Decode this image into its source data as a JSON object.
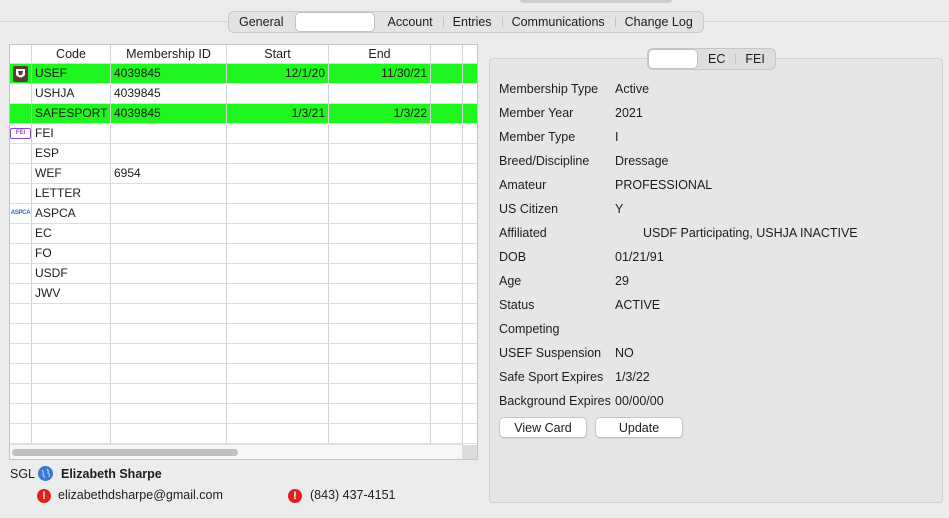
{
  "top_tabs": [
    {
      "label": ""
    },
    {
      "label": "General"
    },
    {
      "label": "Account"
    },
    {
      "label": "Entries"
    },
    {
      "label": "Communications"
    },
    {
      "label": "Change Log"
    }
  ],
  "table": {
    "headers": [
      "",
      "Code",
      "Membership ID",
      "Start",
      "End",
      ""
    ],
    "rows": [
      {
        "icon": "usef-logo-icon",
        "code": "USEF",
        "id": "4039845",
        "start": "12/1/20",
        "end": "11/30/21",
        "highlight": true
      },
      {
        "icon": "",
        "code": "USHJA",
        "id": "4039845",
        "start": "",
        "end": "",
        "highlight": false
      },
      {
        "icon": "",
        "code": "SAFESPORT",
        "id": "4039845",
        "start": "1/3/21",
        "end": "1/3/22",
        "highlight": true
      },
      {
        "icon": "fei-logo-icon",
        "code": "FEI",
        "id": "",
        "start": "",
        "end": "",
        "highlight": false
      },
      {
        "icon": "",
        "code": "ESP",
        "id": "",
        "start": "",
        "end": "",
        "highlight": false
      },
      {
        "icon": "",
        "code": "WEF",
        "id": "6954",
        "start": "",
        "end": "",
        "highlight": false
      },
      {
        "icon": "",
        "code": "LETTER",
        "id": "",
        "start": "",
        "end": "",
        "highlight": false
      },
      {
        "icon": "aspca-logo-icon",
        "code": "ASPCA",
        "id": "",
        "start": "",
        "end": "",
        "highlight": false
      },
      {
        "icon": "",
        "code": "EC",
        "id": "",
        "start": "",
        "end": "",
        "highlight": false
      },
      {
        "icon": "",
        "code": "FO",
        "id": "",
        "start": "",
        "end": "",
        "highlight": false
      },
      {
        "icon": "",
        "code": "USDF",
        "id": "",
        "start": "",
        "end": "",
        "highlight": false
      },
      {
        "icon": "",
        "code": "JWV",
        "id": "",
        "start": "",
        "end": "",
        "highlight": false
      }
    ],
    "highlight_color": "#1ff51f",
    "logo_texts": {
      "fei": "FEI",
      "aspca": "ASPCA"
    }
  },
  "user": {
    "prefix": "SGL",
    "name": "Elizabeth Sharpe",
    "email": "elizabethdsharpe@gmail.com",
    "phone": "(843) 437-4151"
  },
  "sub_tabs": [
    {
      "label": ""
    },
    {
      "label": "EC"
    },
    {
      "label": "FEI"
    }
  ],
  "details": [
    {
      "label": "Membership Type",
      "value": "Active"
    },
    {
      "label": "Member Year",
      "value": "2021"
    },
    {
      "label": "Member Type",
      "value": "I"
    },
    {
      "label": "Breed/Discipline",
      "value": "Dressage"
    },
    {
      "label": "Amateur",
      "value": "PROFESSIONAL"
    },
    {
      "label": "US Citizen",
      "value": "Y"
    },
    {
      "label": "Affiliated",
      "value": "USDF Participating, USHJA INACTIVE"
    },
    {
      "label": "DOB",
      "value": "01/21/91"
    },
    {
      "label": "Age",
      "value": "29"
    },
    {
      "label": "Status",
      "value": "ACTIVE"
    },
    {
      "label": "Competing",
      "value": ""
    },
    {
      "label": "USEF Suspension",
      "value": "NO"
    },
    {
      "label": "Safe Sport Expires",
      "value": "1/3/22"
    },
    {
      "label": "Background Expires",
      "value": "00/00/00"
    }
  ],
  "buttons": {
    "view_card": "View Card",
    "update": "Update"
  }
}
